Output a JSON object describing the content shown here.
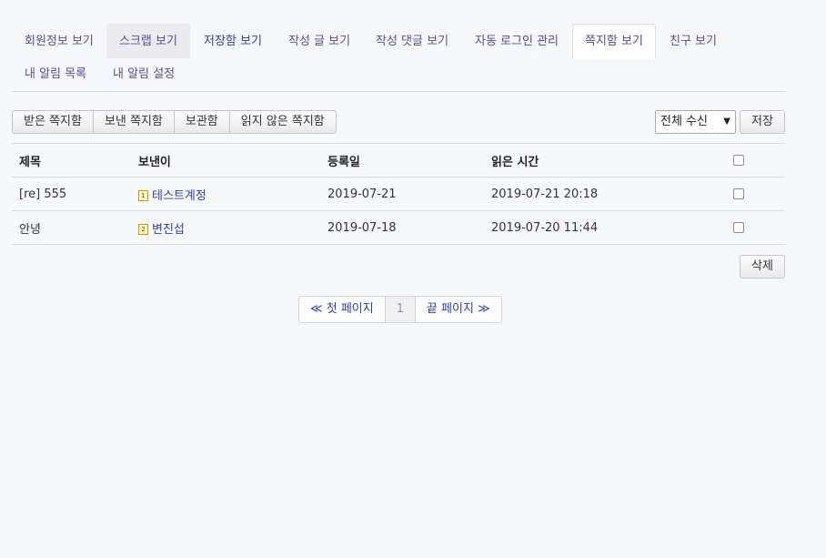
{
  "tabs": [
    {
      "label": "회원정보 보기"
    },
    {
      "label": "스크랩 보기"
    },
    {
      "label": "저장함 보기"
    },
    {
      "label": "작성 글 보기"
    },
    {
      "label": "작성 댓글 보기"
    },
    {
      "label": "자동 로그인 관리"
    },
    {
      "label": "쪽지함 보기"
    },
    {
      "label": "친구 보기"
    },
    {
      "label": "내 알림 목록"
    },
    {
      "label": "내 알림 설정"
    }
  ],
  "toolbar": {
    "received_label": "받은 쪽지함",
    "sent_label": "보낸 쪽지함",
    "archive_label": "보관함",
    "unread_label": "읽지 않은 쪽지함",
    "filter_value": "전체 수신",
    "save_label": "저장"
  },
  "table": {
    "headers": {
      "title": "제목",
      "sender": "보낸이",
      "date": "등록일",
      "read": "읽은 시간"
    },
    "rows": [
      {
        "title": "[re] 555",
        "level": "1",
        "sender": "테스트계정",
        "date": "2019-07-21",
        "read": "2019-07-21 20:18"
      },
      {
        "title": "안녕",
        "level": "2",
        "sender": "변진섭",
        "date": "2019-07-18",
        "read": "2019-07-20 11:44"
      }
    ]
  },
  "delete_label": "삭제",
  "pagination": {
    "first_label": "≪ 첫 페이지",
    "current": "1",
    "last_label": "끝 페이지 ≫"
  }
}
